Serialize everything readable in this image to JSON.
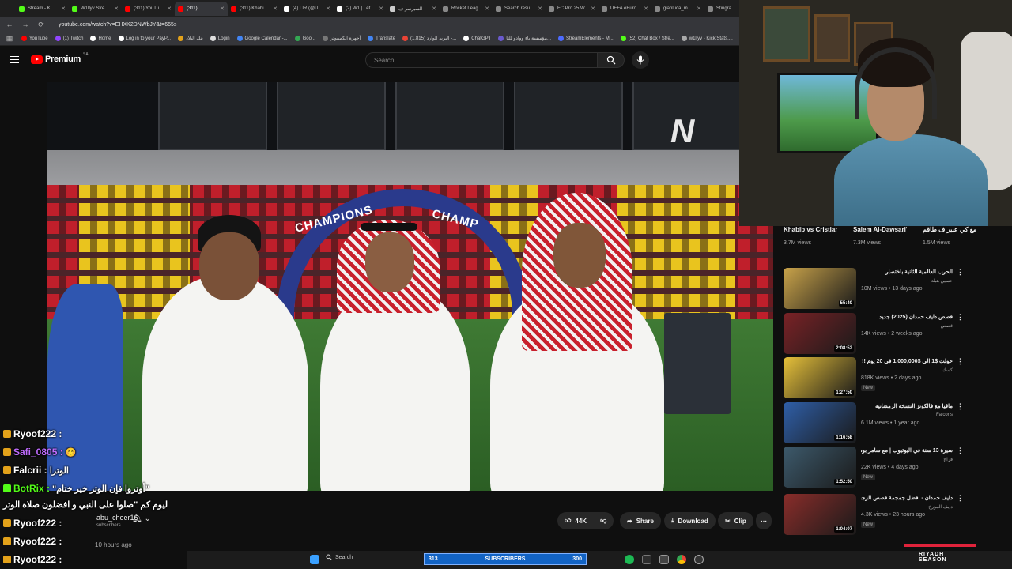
{
  "browser": {
    "tabs": [
      {
        "label": "Stream - Ki",
        "color": "#53fc18",
        "active": false
      },
      {
        "label": "W1llyv Stre",
        "color": "#53fc18",
        "active": false
      },
      {
        "label": "(311) YouTu",
        "color": "#ff0000",
        "active": false
      },
      {
        "label": "(311)",
        "color": "#ff0000",
        "active": true
      },
      {
        "label": "(311) Khabi",
        "color": "#ff0000",
        "active": false
      },
      {
        "label": "(4) LIR (@U",
        "color": "#ffffff",
        "active": false
      },
      {
        "label": "(2) W1 | Let",
        "color": "#ffffff",
        "active": false
      },
      {
        "label": "السيرسر ف",
        "color": "#cccccc",
        "active": false
      },
      {
        "label": "Rocket Leag",
        "color": "#888888",
        "active": false
      },
      {
        "label": "Search resu",
        "color": "#888888",
        "active": false
      },
      {
        "label": "FC Pro 25 W",
        "color": "#888888",
        "active": false
      },
      {
        "label": "UEFA eEuro",
        "color": "#888888",
        "active": false
      },
      {
        "label": "gianluca_m",
        "color": "#888888",
        "active": false
      },
      {
        "label": "Stingra",
        "color": "#888888",
        "active": false
      }
    ],
    "url": "youtube.com/watch?v=EHXK2DNWbJY&t=665s",
    "bookmarks": [
      {
        "label": "YouTube",
        "color": "#ff0000"
      },
      {
        "label": "(1) Twitch",
        "color": "#9146ff"
      },
      {
        "label": "Home",
        "color": "#ffffff"
      },
      {
        "label": "Log in to your PayP...",
        "color": "#ffffff"
      },
      {
        "label": "بنك البلاد",
        "color": "#e3a21a"
      },
      {
        "label": "Login",
        "color": "#dddddd"
      },
      {
        "label": "Google Calendar -...",
        "color": "#4285f4"
      },
      {
        "label": "Goo...",
        "color": "#34a853"
      },
      {
        "label": "أجهزة الكمبيوتر",
        "color": "#777777"
      },
      {
        "label": "Translate",
        "color": "#4285f4"
      },
      {
        "label": "البريد الوارد (1,815) -...",
        "color": "#ea4335"
      },
      {
        "label": "ChatGPT",
        "color": "#ffffff"
      },
      {
        "label": "مؤسسة باء ووادو للتا...",
        "color": "#6a5acd"
      },
      {
        "label": "StreamElements - M...",
        "color": "#4d6bff"
      },
      {
        "label": "(52) Chat Box / Stre...",
        "color": "#53fc18"
      },
      {
        "label": "w1llyv - Kick Stats,...",
        "color": "#aaaaaa"
      }
    ]
  },
  "youtube": {
    "brand": "Premium",
    "country": "SA",
    "search_placeholder": "Search"
  },
  "video": {
    "watermark": "N",
    "arch_left": "CHAMPIONS",
    "arch_right": "CHAMP"
  },
  "chat": [
    {
      "user": "Ryoof222 :",
      "msg": "",
      "color": "#ffffff"
    },
    {
      "user": "Safi_0805 :",
      "msg": "😊",
      "color": "#c06cff"
    },
    {
      "user": "Falcrii :",
      "msg": "الوترا",
      "color": "#ffffff"
    },
    {
      "user": "BotRix :",
      "msg": "\"أوتروا فإن الوتر خير ختام\"",
      "color": "#53fc18"
    },
    {
      "user": "",
      "msg": "ليوم كم \"صلوا على النبي و افضلون صلاة الوتر",
      "color": "#ffffff"
    },
    {
      "user": "Ryoof222 :",
      "msg": "",
      "color": "#ffffff"
    },
    {
      "user": "Ryoof222 :",
      "msg": "",
      "color": "#ffffff"
    },
    {
      "user": "Ryoof222 :",
      "msg": "",
      "color": "#ffffff"
    }
  ],
  "below_video": {
    "channel": "abu_cheer16",
    "subs": "subscribers",
    "like_count": "44K",
    "share": "Share",
    "download": "Download",
    "clip": "Clip",
    "time_ago": "10 hours ago"
  },
  "sidebar": {
    "shorts": [
      {
        "title": "Khabib vs Cristiano ...",
        "views": "3.7M views"
      },
      {
        "title": "Salem Al-Dawsari's ...",
        "views": "7.3M views"
      },
      {
        "title": "مقلب مسلسل مع كي عبير ف طاقم",
        "views": "1.5M views"
      }
    ],
    "recommended": [
      {
        "title": "الحرب العالمية الثانية باختصار",
        "channel": "حسين هبلة",
        "views": "10M views • 13 days ago",
        "duration": "55:40",
        "new": "",
        "thumb": "#c9a34a"
      },
      {
        "title": "قصص دايف حمدان (2025) جديد",
        "channel": "قصص",
        "views": "14K views • 2 weeks ago",
        "duration": "2:08:52",
        "new": "",
        "thumb": "#7a2226"
      },
      {
        "title": "حولت $1 الى $1,000,000 في 20 يوم !!",
        "channel": "كسك",
        "views": "818K views • 2 days ago",
        "duration": "1:27:50",
        "new": "New",
        "thumb": "#e7c13a"
      },
      {
        "title": "ماقيا مع فالكونز النسخة الرمضانية",
        "channel": "Falcons",
        "views": "6.1M views • 1 year ago",
        "duration": "1:16:58",
        "new": "",
        "thumb": "#2f5fa8"
      },
      {
        "title": "سيرة 13 سنة في اليوتيوب | مع سامر بودكاست من الآخر",
        "channel": "فراج",
        "views": "22K views • 4 days ago",
        "duration": "1:52:50",
        "new": "New",
        "thumb": "#3d5a6c"
      },
      {
        "title": "دايف حمدان - افضل جمجمة قصص الزجه",
        "channel": "دايف المؤرخ",
        "views": "4.3K views • 23 hours ago",
        "duration": "1:04:07",
        "new": "New",
        "thumb": "#8a2d2a"
      }
    ]
  },
  "taskbar": {
    "search": "Search",
    "subs_left": "313",
    "subs_label": "SUBSCRIBERS",
    "subs_right": "300",
    "season_line1": "RIYADH",
    "season_line2": "SEASON"
  }
}
